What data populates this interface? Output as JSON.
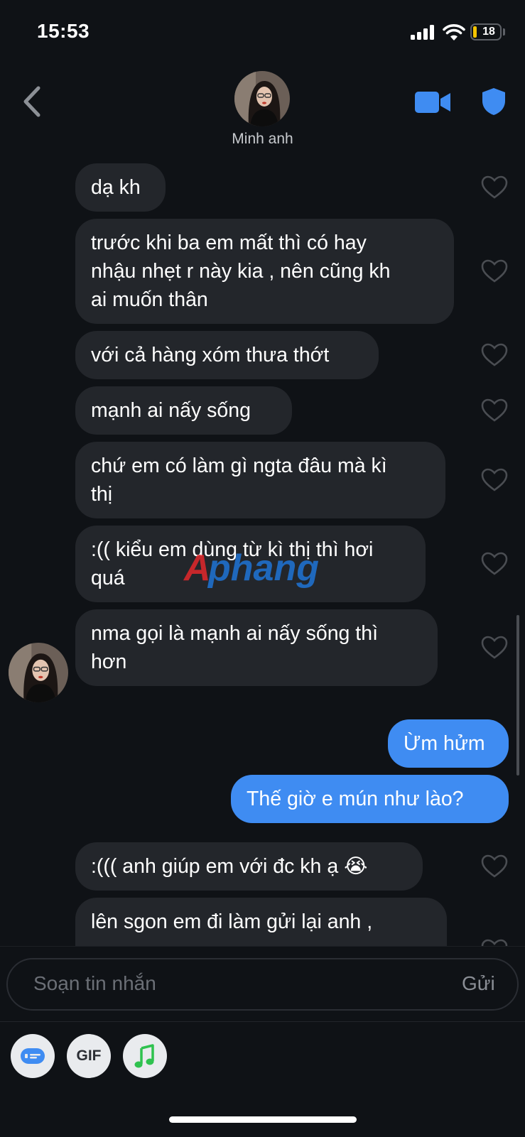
{
  "status": {
    "time": "15:53",
    "battery": "18"
  },
  "header": {
    "contact_name": "Minh anh"
  },
  "messages": [
    {
      "dir": "in",
      "text": "dạ kh"
    },
    {
      "dir": "in",
      "text": "trước khi ba em mất thì có hay\nnhậu nhẹt r này kia , nên cũng kh\nai muốn thân"
    },
    {
      "dir": "in",
      "text": "với cả hàng xóm thưa thớt"
    },
    {
      "dir": "in",
      "text": "mạnh ai nấy sống"
    },
    {
      "dir": "in",
      "text": "chứ em có làm gì ngta đâu mà kì\nthị"
    },
    {
      "dir": "in",
      "text": ":(( kiểu em dùng từ kì thị thì hơi\nquá"
    },
    {
      "dir": "in",
      "text": "nma gọi là mạnh ai nấy sống thì\nhơn"
    },
    {
      "dir": "out",
      "text": "Ừm hửm"
    },
    {
      "dir": "out",
      "text": "Thế giờ e mún như lào?"
    },
    {
      "dir": "in",
      "text": ":((( anh giúp em với đc kh ạ 😭"
    },
    {
      "dir": "in",
      "text": "lên sgon em đi làm gửi lại anh ,"
    }
  ],
  "composer": {
    "placeholder": "Soạn tin nhắn",
    "send_label": "Gửi",
    "gif_label": "GIF"
  },
  "watermark": "Ap hang",
  "colors": {
    "accent": "#3f8cf2",
    "incoming_bubble": "#23262b",
    "background": "#0f1216"
  }
}
